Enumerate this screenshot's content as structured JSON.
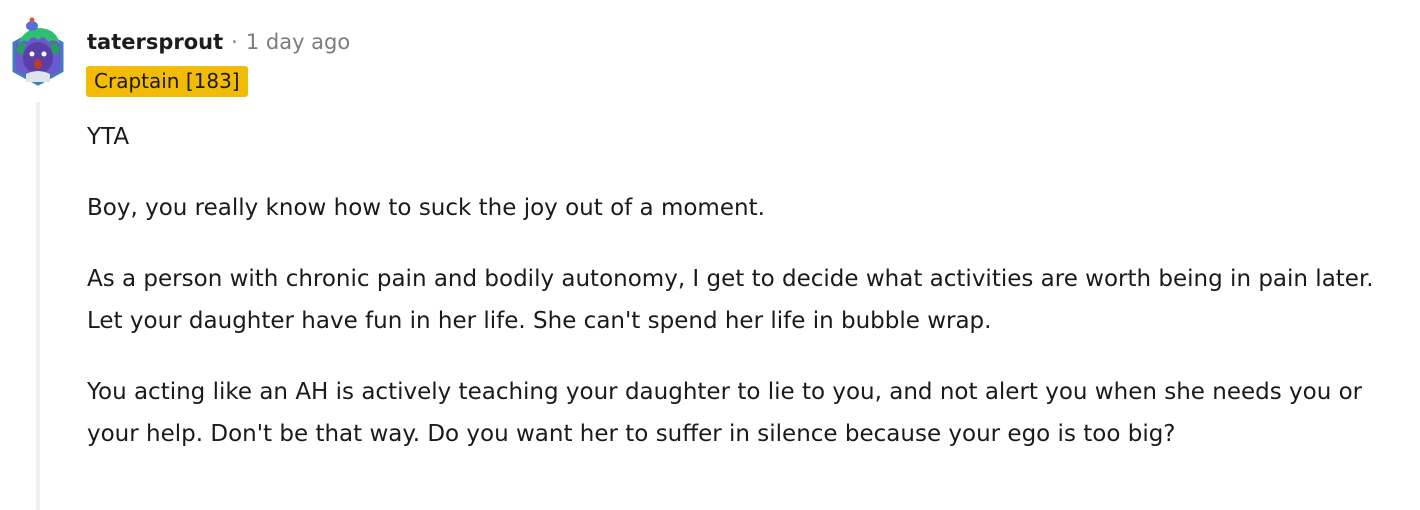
{
  "comment": {
    "author": "tatersprout",
    "separator": "·",
    "timestamp": "1 day ago",
    "flair": "Craptain [183]",
    "flair_color": "#f2bb05",
    "avatar": "snoo-avatar-icon",
    "paragraphs": [
      "YTA",
      "Boy, you really know how to suck the joy out of a moment.",
      "As a person with chronic pain and bodily autonomy, I get to decide what activities are worth being in pain later. Let your daughter have fun in her life. She can't spend her life in bubble wrap.",
      "You acting like an AH is actively teaching your daughter to lie to you, and not alert you when she needs you or your help. Don't be that way. Do you want her to suffer in silence because your ego is too big?"
    ]
  }
}
